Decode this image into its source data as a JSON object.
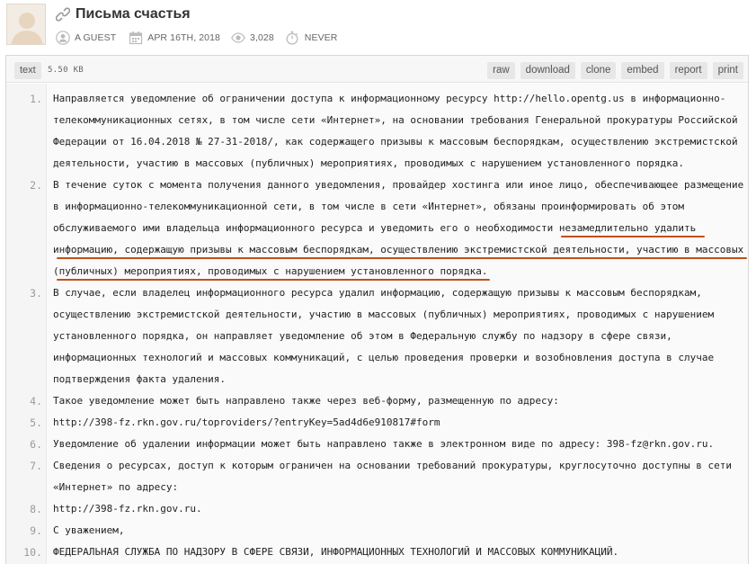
{
  "header": {
    "title": "Письма счастья",
    "author": "A GUEST",
    "date": "APR 16TH, 2018",
    "views": "3,028",
    "expires": "NEVER"
  },
  "toolbar": {
    "language": "text",
    "size": "5.50 KB",
    "buttons": [
      "raw",
      "download",
      "clone",
      "embed",
      "report",
      "print"
    ]
  },
  "lines": [
    {
      "num": "1.",
      "rows": [
        "Направляется уведомление об ограничении доступа к информационному ресурсу http://hello.opentg.us в информационно-",
        "телекоммуникационных сетях, в том числе сети «Интернет», на основании требования Генеральной прокуратуры Российской",
        "Федерации от 16.04.2018 № 27-31-2018/, как содержащего призывы к массовым беспорядкам, осуществлению экстремистской",
        "деятельности, участию в массовых (публичных) мероприятиях, проводимых с нарушением установленного порядка."
      ]
    },
    {
      "num": "2.",
      "rows": [
        "В течение суток с момента получения данного уведомления, провайдер хостинга или иное лицо, обеспечивающее размещение",
        "в информационно-телекоммуникационной сети, в том числе в сети «Интернет», обязаны проинформировать об этом",
        "обслуживаемого ими владельца информационного ресурса и уведомить его о необходимости незамедлительно удалить",
        "информацию, содержащую призывы к массовым беспорядкам, осуществлению экстремистской деятельности, участию в массовых",
        "(публичных) мероприятиях, проводимых с нарушением установленного порядка."
      ]
    },
    {
      "num": "3.",
      "rows": [
        "В случае, если владелец информационного ресурса удалил информацию, содержащую призывы к массовым беспорядкам,",
        "осуществлению экстремистской деятельности, участию в массовых (публичных) мероприятиях, проводимых с нарушением",
        "установленного порядка, он направляет уведомление об этом в Федеральную службу по надзору в сфере связи,",
        "информационных технологий и массовых коммуникаций, с целью проведения проверки и возобновления доступа в случае",
        "подтверждения факта удаления."
      ]
    },
    {
      "num": "4.",
      "rows": [
        "Такое уведомление может быть направлено также через веб-форму, размещенную по адресу:"
      ]
    },
    {
      "num": "5.",
      "rows": [
        "http://398-fz.rkn.gov.ru/toproviders/?entryKey=5ad4d6e910817#form"
      ]
    },
    {
      "num": "6.",
      "rows": [
        "Уведомление об удалении информации может быть направлено также в электронном виде по адресу: 398-fz@rkn.gov.ru."
      ]
    },
    {
      "num": "7.",
      "rows": [
        "Сведения о ресурсах, доступ к которым ограничен на основании требований прокуратуры, круглосуточно доступны в сети",
        "«Интернет» по адресу:"
      ]
    },
    {
      "num": "8.",
      "rows": [
        "http://398-fz.rkn.gov.ru."
      ]
    },
    {
      "num": "9.",
      "rows": [
        "С уважением,"
      ]
    },
    {
      "num": "10.",
      "rows": [
        "ФЕДЕРАЛЬНАЯ СЛУЖБА ПО НАДЗОРУ В СФЕРЕ СВЯЗИ, ИНФОРМАЦИОННЫХ ТЕХНОЛОГИЙ И МАССОВЫХ КОММУНИКАЦИЙ."
      ]
    }
  ],
  "colors": {
    "underline": "#c0501c",
    "line_numbers": "#9a9a9a",
    "toolbar_button_bg": "#e7e7e7"
  }
}
